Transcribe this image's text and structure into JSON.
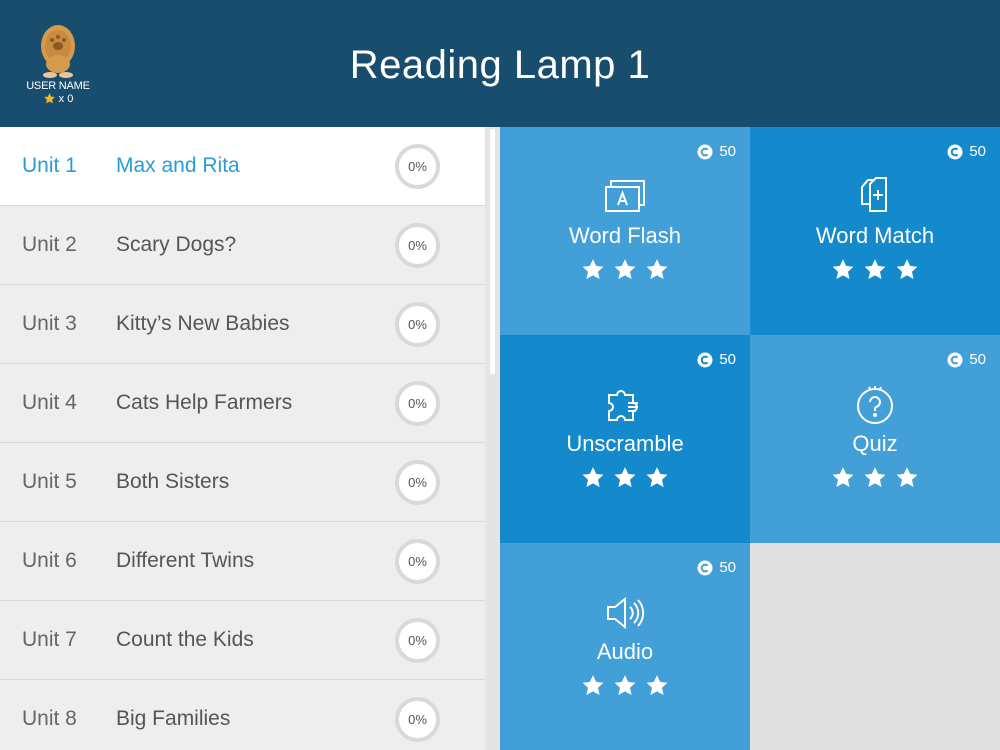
{
  "header": {
    "title": "Reading Lamp 1",
    "user_name": "USER NAME",
    "star_count": "x  0"
  },
  "units": [
    {
      "num": "Unit 1",
      "name": "Max and Rita",
      "progress": "0%",
      "active": true
    },
    {
      "num": "Unit 2",
      "name": "Scary Dogs?",
      "progress": "0%"
    },
    {
      "num": "Unit 3",
      "name": "Kitty’s New Babies",
      "progress": "0%"
    },
    {
      "num": "Unit 4",
      "name": "Cats Help Farmers",
      "progress": "0%"
    },
    {
      "num": "Unit 5",
      "name": "Both Sisters",
      "progress": "0%"
    },
    {
      "num": "Unit 6",
      "name": "Different Twins",
      "progress": "0%"
    },
    {
      "num": "Unit 7",
      "name": "Count the Kids",
      "progress": "0%"
    },
    {
      "num": "Unit 8",
      "name": "Big Families",
      "progress": "0%"
    }
  ],
  "activities": [
    {
      "label": "Word Flash",
      "coins": "50",
      "icon": "flashcard-icon",
      "stars": 3
    },
    {
      "label": "Word Match",
      "coins": "50",
      "icon": "card-match-icon",
      "stars": 3
    },
    {
      "label": "Unscramble",
      "coins": "50",
      "icon": "puzzle-icon",
      "stars": 3
    },
    {
      "label": "Quiz",
      "coins": "50",
      "icon": "question-icon",
      "stars": 3
    },
    {
      "label": "Audio",
      "coins": "50",
      "icon": "speaker-icon",
      "stars": 3
    }
  ],
  "colors": {
    "header_bg": "#184d6e",
    "tile_light": "#429fd8",
    "tile_dark": "#1489cc",
    "active_unit_text": "#2b9bd8",
    "star_gold": "#f3b81f"
  }
}
